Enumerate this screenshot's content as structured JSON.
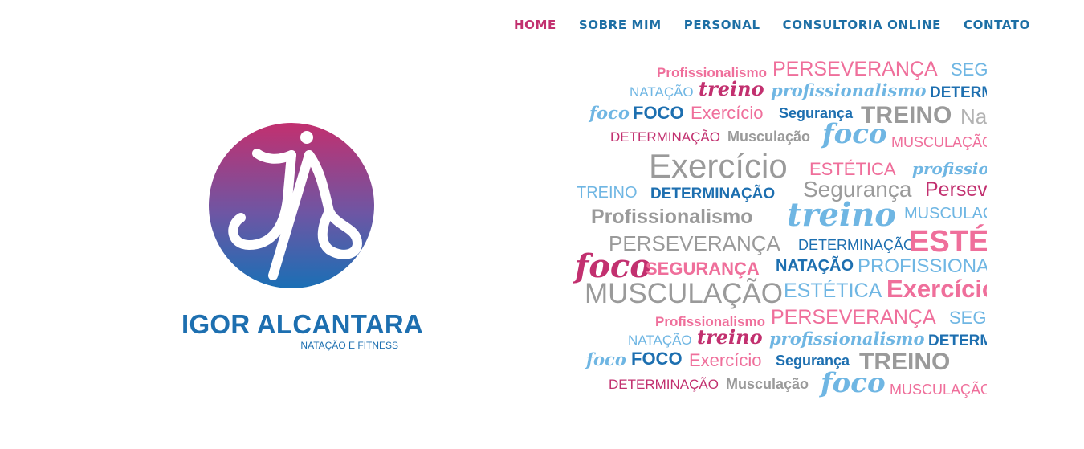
{
  "nav": {
    "items": [
      {
        "label": "HOME",
        "active": true
      },
      {
        "label": "SOBRE MIM",
        "active": false
      },
      {
        "label": "PERSONAL",
        "active": false
      },
      {
        "label": "CONSULTORIA ONLINE",
        "active": false
      },
      {
        "label": "CONTATO",
        "active": false
      }
    ]
  },
  "brand": {
    "name": "IGOR ALCANTARA",
    "tagline": "NATAÇÃO E FITNESS",
    "monogram": "IA",
    "colors": {
      "gradient_top": "#c2306f",
      "gradient_bottom": "#1a6fb5",
      "text": "#1d6fb0"
    }
  },
  "word_cloud": {
    "words": [
      "Profissionalismo",
      "PERSEVERANÇA",
      "SEGURANÇA",
      "NATAÇÃO",
      "treino",
      "profissionalismo",
      "DETERMINAÇÃO",
      "foco",
      "FOCO",
      "Exercício",
      "Segurança",
      "TREINO",
      "Natação",
      "DETERMINAÇÃO",
      "Musculação",
      "foco",
      "MUSCULAÇÃO",
      "Exercício",
      "ESTÉTICA",
      "profissionalismo",
      "TREINO",
      "DETERMINAÇÃO",
      "Segurança",
      "Perseverança",
      "Profissionalismo",
      "treino",
      "MUSCULAÇÃO",
      "PERSEVERANÇA",
      "DETERMINAÇÃO",
      "ESTÉTICA",
      "foco",
      "SEGURANÇA",
      "NATAÇÃO",
      "PROFISSIONALISMO",
      "MUSCULAÇÃO",
      "ESTÉTICA",
      "Exercício",
      "Profissionalismo",
      "PERSEVERANÇA",
      "SEGURANÇA",
      "NATAÇÃO",
      "treino",
      "profissionalismo",
      "DETERMINAÇÃO",
      "foco",
      "FOCO",
      "Exercício",
      "Segurança",
      "TREINO",
      "DETERMINAÇÃO",
      "Musculação",
      "foco",
      "MUSCULAÇÃO"
    ],
    "colors": {
      "pink": "#ef6f9b",
      "magenta": "#c2306f",
      "light_blue": "#6fb6e3",
      "blue": "#1d6fb0",
      "gray": "#9a9a9a",
      "light_gray": "#b3b3b3"
    }
  }
}
